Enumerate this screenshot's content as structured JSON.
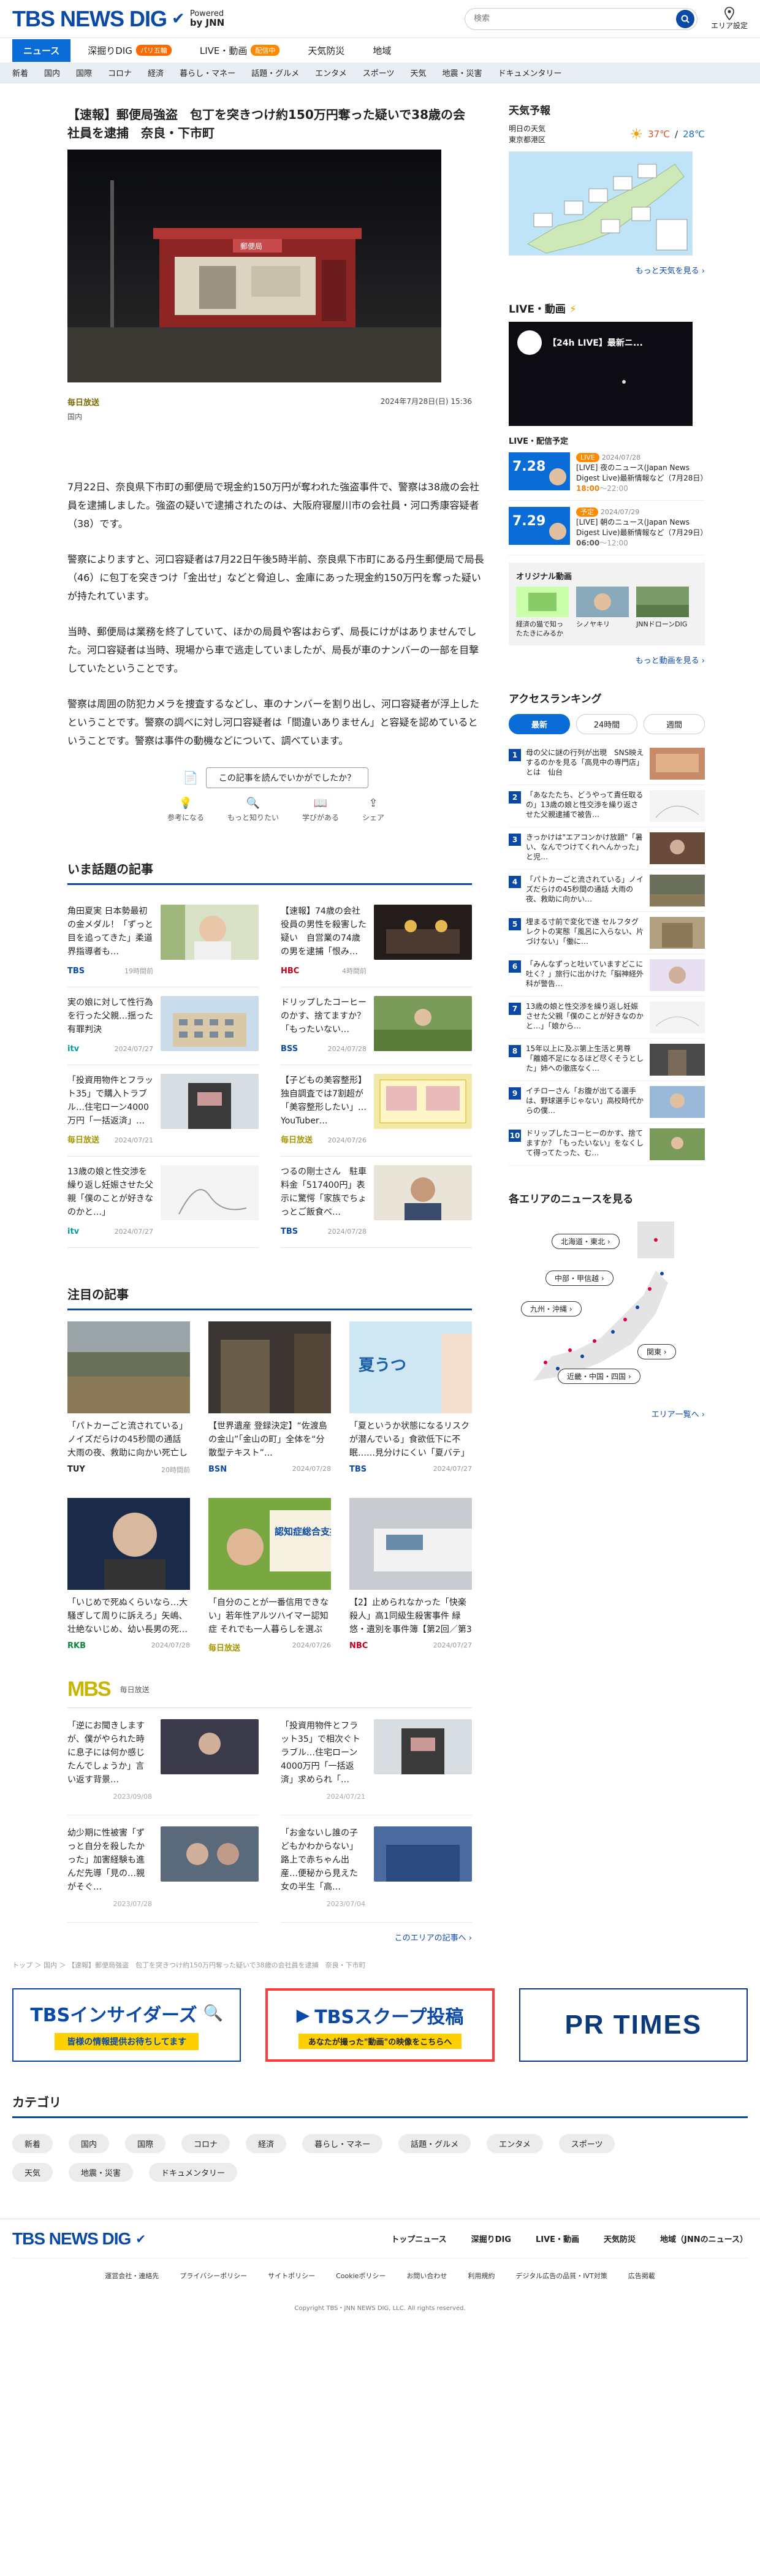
{
  "header": {
    "logo": "TBS NEWS DIG",
    "powered": "Powered",
    "by": "by JNN",
    "search_placeholder": "検索",
    "area_setting": "エリア設定"
  },
  "tabs": [
    {
      "label": "ニュース"
    },
    {
      "label": "深掘りDIG",
      "badge": "パリ五輪"
    },
    {
      "label": "LIVE・動画",
      "badge": "配信中"
    },
    {
      "label": "天気防災"
    },
    {
      "label": "地域"
    }
  ],
  "categories": [
    "新着",
    "国内",
    "国際",
    "コロナ",
    "経済",
    "暮らし・マネー",
    "話題・グルメ",
    "エンタメ",
    "スポーツ",
    "天気",
    "地震・災害",
    "ドキュメンタリー"
  ],
  "article": {
    "title": "【速報】郵便局強盗　包丁を突きつけ約150万円奪った疑いで38歳の会社員を逮捕　奈良・下市町",
    "source": "毎日放送",
    "date": "2024年7月28日(日) 15:36",
    "tag": "国内",
    "post_sign": "郵便局",
    "paragraphs": [
      "7月22日、奈良県下市町の郵便局で現金約150万円が奪われた強盗事件で、警察は38歳の会社員を逮捕しました。強盗の疑いで逮捕されたのは、大阪府寝屋川市の会社員・河口秀康容疑者（38）です。",
      "警察によりますと、河口容疑者は7月22日午後5時半前、奈良県下市町にある丹生郵便局で局長（46）に包丁を突きつけ「金出せ」などと脅迫し、金庫にあった現金約150万円を奪った疑いが持たれています。",
      "当時、郵便局は業務を終了していて、ほかの局員や客はおらず、局長にけがはありませんでした。河口容疑者は当時、現場から車で逃走していましたが、局長が車のナンバーの一部を目撃していたということです。",
      "警察は周囲の防犯カメラを捜査するなどし、車のナンバーを割り出し、河口容疑者が浮上したということです。警察の調べに対し河口容疑者は「間違いありません」と容疑を認めているということです。警察は事件の動機などについて、調べています。"
    ],
    "reaction_question": "この記事を読んでいかがでしたか？",
    "reactions": [
      "参考になる",
      "もっと知りたい",
      "学びがある",
      "シェア"
    ]
  },
  "topics": {
    "title": "いま話題の記事",
    "items": [
      {
        "text": "角田夏実 日本勢最初の金メダル！「ずっと目を追ってきた」柔道界指導者も…",
        "source": "TBS",
        "time": "19時間前"
      },
      {
        "text": "【速報】74歳の会社役員の男性を殺害した疑い　自営業の74歳の男を逮捕「恨み…",
        "source": "HBC",
        "time": "4時間前"
      },
      {
        "text": "実の娘に対して性行為を行った父親…揺った有罪判決",
        "source": "itv",
        "time": "2024/07/27"
      },
      {
        "text": "ドリップしたコーヒーのかす、捨てますか？「もったいない…",
        "source": "BSS",
        "time": "2024/07/28"
      },
      {
        "text": "「投資用物件とフラット35」で購入トラブル…住宅ローン4000万円「一括返済」…",
        "source": "毎日放送",
        "time": "2024/07/21"
      },
      {
        "text": "【子どもの美容整形】独自調査では7割超が「美容整形したい」…YouTuber…",
        "source": "毎日放送",
        "time": "2024/07/26"
      },
      {
        "text": "13歳の娘と性交渉を繰り返し妊娠させた父親「僕のことが好きなのかと…」",
        "source": "itv",
        "time": "2024/07/27"
      },
      {
        "text": "つるの剛士さん　駐車料金「517400円」表示に驚愕「家族でちょっとご飯食べ…",
        "source": "TBS",
        "time": "2024/07/28"
      }
    ]
  },
  "featured": {
    "title": "注目の記事",
    "items": [
      {
        "text": "「パトカーごと流されている」ノイズだらけの45秒間の通話 大雨の夜、救助に向かい死亡した巡査長…",
        "source": "TUY",
        "time": "20時間前"
      },
      {
        "text": "【世界遺産 登録決定】“佐渡島の金山”「金山の町」全体を“分散型テキスト”…",
        "source": "BSN",
        "time": "2024/07/28"
      },
      {
        "text": "「夏というか状態になるリスクが潜んでいる」食欲低下に不眠……見分けにくい「夏バテ」と「夏うつ」…",
        "source": "TBS",
        "time": "2024/07/27"
      },
      {
        "text": "「いじめで死ぬくらいなら…大騒ぎして周りに訴えろ」矢嶋、壮絶ないじめ、幼い長男の死…多くの苦難…",
        "source": "RKB",
        "time": "2024/07/28"
      },
      {
        "text": "「自分のことが一番信用できない」若年性アルツハイマー認知症 それでも一人暮らしを選ぶ52歳…",
        "source": "毎日放送",
        "time": "2024/07/26"
      },
      {
        "text": "【2】止められなかった「快楽殺人」高1同級生殺害事件 緑悠・遺別を事件簿【第2回／第3回】",
        "source": "NBC",
        "time": "2024/07/27"
      }
    ],
    "photo_text": "認知症総合支援 期待と課題",
    "photo_text2": "夏うつ"
  },
  "mbs": {
    "logo": "MBS",
    "label": "毎日放送",
    "items": [
      {
        "text": "「逆にお聞きしますが、僕がやられた時に息子には何か感じたんでしょうか」言い返す背景…",
        "date": "2023/09/08"
      },
      {
        "text": "「投資用物件とフラット35」で相次ぐトラブル…住宅ローン4000万円「一括返済」求められ「…",
        "date": "2024/07/21"
      },
      {
        "text": "幼少期に性被害「ずっと自分を殺したかった」加害経験も進んだ先導「見の…親がそぐ…",
        "date": "2023/07/28"
      },
      {
        "text": "「お金ないし誰の子どもかわからない」路上で赤ちゃん出産…便秘から見えた女の半生「高…",
        "date": "2023/07/04"
      }
    ],
    "more": "このエリアの記事へ ›"
  },
  "breadcrumb": "トップ ＞ 国内 ＞ 【速報】郵便局強盗　包丁を突きつけ約150万円奪った疑いで38歳の会社員を逮捕　奈良・下市町",
  "banners": {
    "insiders": "TBSインサイダーズ",
    "insiders_sub": "皆様の情報提供お待ちしてます",
    "scoop": "TBSスクープ投稿",
    "scoop_sub": "あなたが撮った\"動画\"の映像をこちらへ",
    "prtimes": "PR TIMES"
  },
  "category_section": {
    "title": "カテゴリ"
  },
  "sidebar": {
    "weather": {
      "title": "天気予報",
      "label1": "明日の天気",
      "label2": "東京都港区",
      "high": "37℃",
      "low": "28℃",
      "more": "もっと天気を見る ›"
    },
    "live": {
      "title": "LIVE・動画",
      "video_title": "【24h LIVE】最新ニ...",
      "schedule_title": "LIVE・配信予定",
      "progs": [
        {
          "badge": "LIVE",
          "date": "2024/07/28",
          "day": "7.28",
          "text": "[LIVE] 夜のニュース(Japan News Digest Live)最新情報など（7月28日）",
          "time": "18:00",
          "end": "～22:00"
        },
        {
          "badge": "予定",
          "date": "2024/07/29",
          "day": "7.29",
          "text": "[LIVE] 朝のニュース(Japan News Digest Live)最新情報など（7月29日）",
          "time": "06:00",
          "end": "～12:00"
        }
      ],
      "original_title": "オリジナル動画",
      "orig": [
        "経済の猫で知ったたきにみるか",
        "シノヤキリ",
        "JNNドローンDIG"
      ],
      "more": "もっと動画を見る ›"
    },
    "ranking": {
      "title": "アクセスランキング",
      "tabs": [
        "最新",
        "24時間",
        "週間"
      ],
      "items": [
        "母の父に謎の行列が出現　SNS映えするのかを見る「高見中の専門店」とは　仙台",
        "「あなたたち、どうやって責任取るの」13歳の娘と性交渉を繰り返させた父親逮捕で被告…",
        "きっかけは\"エアコンかけ放題\"「暑い、なんでつけてくれへんかった」と児…",
        "「パトカーごと流されている」ノイズだらけの45秒間の通話 大雨の夜、救助に向かい…",
        "埋まる寸前で変化で遂 セルフタグレクトの実態「風呂に入らない、片づけない」「働に…",
        "「みんなずっと吐いていますどこに吐く？」旅行に出かけた「脳神経外科が警告…",
        "13歳の娘と性交渉を繰り返し妊娠させた父親「僕のことが好きなのかと…」「娘から…",
        "15年以上に及ぶ第上生活と男尊「離婚不足になるほど尽くそうとした」姉への徹底なく…",
        "イチローさん「お腹が出てる選手は、野球選手じゃない」高校時代からの僕…",
        "ドリップしたコーヒーのかす、捨てますか？「もったいない」をなくして得ってたった、む…"
      ]
    },
    "area": {
      "title": "各エリアのニュースを見る",
      "pills": [
        "北海道・東北 ›",
        "中部・甲信越 ›",
        "九州・沖縄 ›",
        "関東 ›",
        "近畿・中国・四国 ›"
      ],
      "more": "エリア一覧へ ›"
    }
  },
  "footer": {
    "logo": "TBS NEWS DIG",
    "nav": [
      "トップニュース",
      "深掘りDIG",
      "LIVE・動画",
      "天気防災",
      "地域（JNNのニュース）"
    ],
    "links": [
      "運営会社・連絡先",
      "プライバシーポリシー",
      "サイトポリシー",
      "Cookieポリシー",
      "お問い合わせ",
      "利用規約",
      "デジタル広告の品質・IVT対策",
      "広告掲載"
    ],
    "copyright": "Copyright TBS・JNN NEWS DIG, LLC. All rights reserved."
  },
  "colors": {
    "brand": "#0a4aa6",
    "accent": "#0a6cd6",
    "live_badge": "#ff8a00"
  }
}
